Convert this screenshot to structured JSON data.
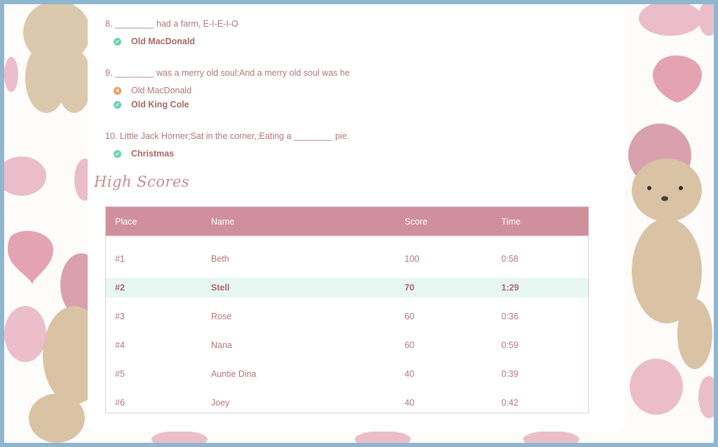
{
  "questions": [
    {
      "text": "8. ________ had a farm, E-I-E-I-O",
      "answers": [
        {
          "text": "Old MacDonald",
          "status": "correct"
        }
      ]
    },
    {
      "text": "9. ________ was a merry old soul;And a merry old soul was he",
      "answers": [
        {
          "text": "Old MacDonald",
          "status": "wrong"
        },
        {
          "text": "Old King Cole",
          "status": "correct"
        }
      ]
    },
    {
      "text": "10. Little Jack Horner;Sat in the corner,;Eating a ________ pie.",
      "answers": [
        {
          "text": "Christmas",
          "status": "correct"
        }
      ]
    }
  ],
  "high_scores": {
    "title": "High Scores",
    "columns": [
      "Place",
      "Name",
      "Score",
      "Time"
    ],
    "rows": [
      {
        "place": "#1",
        "name": "Beth",
        "score": "100",
        "time": "0:58",
        "highlighted": false
      },
      {
        "place": "#2",
        "name": "Stell",
        "score": "70",
        "time": "1:29",
        "highlighted": true
      },
      {
        "place": "#3",
        "name": "Rose",
        "score": "60",
        "time": "0:36",
        "highlighted": false
      },
      {
        "place": "#4",
        "name": "Nana",
        "score": "60",
        "time": "0:59",
        "highlighted": false
      },
      {
        "place": "#5",
        "name": "Auntie Dina",
        "score": "40",
        "time": "0:39",
        "highlighted": false
      },
      {
        "place": "#6",
        "name": "Joey",
        "score": "40",
        "time": "0:42",
        "highlighted": false
      }
    ]
  },
  "icons": {
    "correct": "check-circle-icon",
    "wrong": "x-circle-icon"
  },
  "colors": {
    "frame": "#8fb6cf",
    "table_header": "#d08f9d",
    "highlight_row": "#e8f7f1",
    "correct": "#6fd0b6",
    "wrong": "#ef9a52",
    "text": "#b07779"
  }
}
